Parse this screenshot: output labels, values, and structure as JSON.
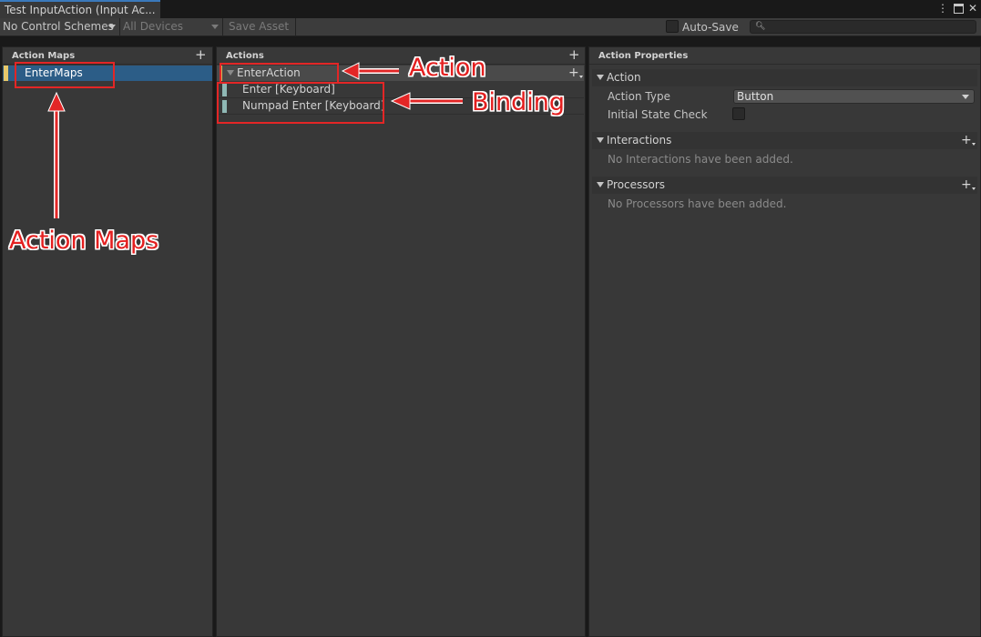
{
  "window": {
    "tab_title": "Test InputAction (Input Ac...",
    "menu_icon": "kebab-menu-icon",
    "maximize_icon": "maximize-icon",
    "close_icon": "close-icon"
  },
  "toolbar": {
    "control_schemes": "No Control Schemes",
    "devices": "All Devices",
    "save_asset": "Save Asset",
    "auto_save": "Auto-Save",
    "auto_save_checked": false,
    "search_placeholder": ""
  },
  "action_maps": {
    "title": "Action Maps",
    "items": [
      {
        "label": "EnterMaps",
        "selected": true
      }
    ]
  },
  "actions": {
    "title": "Actions",
    "action": {
      "label": "EnterAction"
    },
    "bindings": [
      {
        "label": "Enter [Keyboard]"
      },
      {
        "label": "Numpad Enter [Keyboard]"
      }
    ]
  },
  "properties": {
    "title": "Action Properties",
    "action_section": "Action",
    "action_type_label": "Action Type",
    "action_type_value": "Button",
    "initial_state_label": "Initial State Check",
    "initial_state_checked": false,
    "interactions_section": "Interactions",
    "interactions_empty": "No Interactions have been added.",
    "processors_section": "Processors",
    "processors_empty": "No Processors have been added."
  },
  "annotations": {
    "action": "Action",
    "binding": "Binding",
    "action_maps": "Action Maps"
  },
  "colors": {
    "selection": "#2c5d87",
    "annotation_red": "#e32626",
    "action_marker": "#d2b85a",
    "binding_marker": "#8fb8b5",
    "map_marker": "#e7c86a"
  }
}
